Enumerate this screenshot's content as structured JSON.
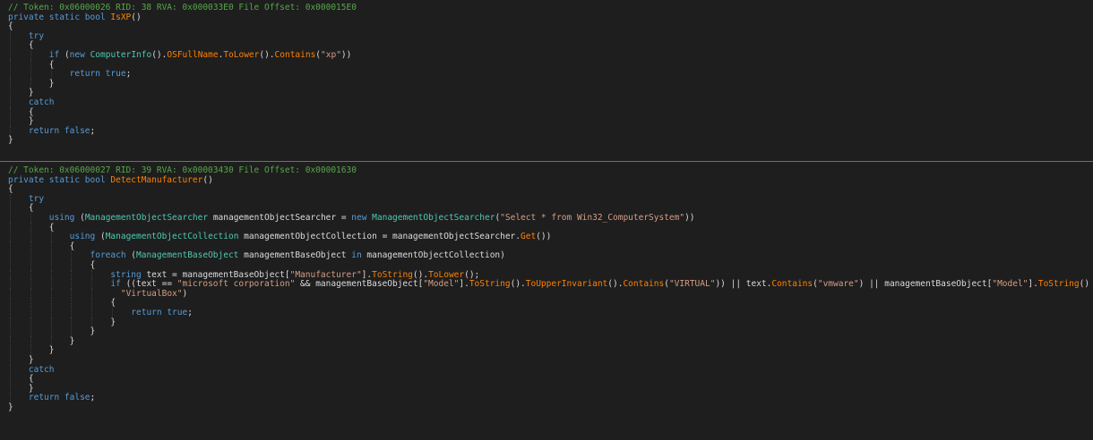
{
  "panes": [
    {
      "lines": [
        [
          [
            "c",
            "// Token: 0x06000026 RID: 38 RVA: 0x000033E0 File Offset: 0x000015E0"
          ]
        ],
        [
          [
            "k",
            "private static bool "
          ],
          [
            "m",
            "IsXP"
          ],
          [
            "p",
            "()"
          ]
        ],
        [
          [
            "p",
            "{"
          ]
        ],
        [
          [
            "p",
            "    "
          ],
          [
            "k",
            "try"
          ]
        ],
        [
          [
            "p",
            "    {"
          ]
        ],
        [
          [
            "p",
            "        "
          ],
          [
            "k",
            "if"
          ],
          [
            "p",
            " ("
          ],
          [
            "k",
            "new "
          ],
          [
            "t",
            "ComputerInfo"
          ],
          [
            "p",
            "()."
          ],
          [
            "m",
            "OSFullName"
          ],
          [
            "p",
            "."
          ],
          [
            "m",
            "ToLower"
          ],
          [
            "p",
            "()."
          ],
          [
            "m",
            "Contains"
          ],
          [
            "p",
            "("
          ],
          [
            "s",
            "\"xp\""
          ],
          [
            "p",
            "))"
          ]
        ],
        [
          [
            "p",
            "        {"
          ]
        ],
        [
          [
            "p",
            "            "
          ],
          [
            "k",
            "return true"
          ],
          [
            "p",
            ";"
          ]
        ],
        [
          [
            "p",
            "        }"
          ]
        ],
        [
          [
            "p",
            "    }"
          ]
        ],
        [
          [
            "p",
            "    "
          ],
          [
            "k",
            "catch"
          ]
        ],
        [
          [
            "p",
            "    {"
          ]
        ],
        [
          [
            "p",
            "    }"
          ]
        ],
        [
          [
            "p",
            "    "
          ],
          [
            "k",
            "return false"
          ],
          [
            "p",
            ";"
          ]
        ],
        [
          [
            "p",
            "}"
          ]
        ]
      ]
    },
    {
      "lines": [
        [
          [
            "c",
            "// Token: 0x06000027 RID: 39 RVA: 0x00003430 File Offset: 0x00001630"
          ]
        ],
        [
          [
            "k",
            "private static bool "
          ],
          [
            "m",
            "DetectManufacturer"
          ],
          [
            "p",
            "()"
          ]
        ],
        [
          [
            "p",
            "{"
          ]
        ],
        [
          [
            "p",
            "    "
          ],
          [
            "k",
            "try"
          ]
        ],
        [
          [
            "p",
            "    {"
          ]
        ],
        [
          [
            "p",
            "        "
          ],
          [
            "k",
            "using"
          ],
          [
            "p",
            " ("
          ],
          [
            "t",
            "ManagementObjectSearcher"
          ],
          [
            "p",
            " managementObjectSearcher = "
          ],
          [
            "k",
            "new "
          ],
          [
            "t",
            "ManagementObjectSearcher"
          ],
          [
            "p",
            "("
          ],
          [
            "s",
            "\"Select * from Win32_ComputerSystem\""
          ],
          [
            "p",
            "))"
          ]
        ],
        [
          [
            "p",
            "        {"
          ]
        ],
        [
          [
            "p",
            "            "
          ],
          [
            "k",
            "using"
          ],
          [
            "p",
            " ("
          ],
          [
            "t",
            "ManagementObjectCollection"
          ],
          [
            "p",
            " managementObjectCollection = managementObjectSearcher."
          ],
          [
            "m",
            "Get"
          ],
          [
            "p",
            "())"
          ]
        ],
        [
          [
            "p",
            "            {"
          ]
        ],
        [
          [
            "p",
            "                "
          ],
          [
            "k",
            "foreach"
          ],
          [
            "p",
            " ("
          ],
          [
            "t",
            "ManagementBaseObject"
          ],
          [
            "p",
            " managementBaseObject "
          ],
          [
            "k",
            "in"
          ],
          [
            "p",
            " managementObjectCollection)"
          ]
        ],
        [
          [
            "p",
            "                {"
          ]
        ],
        [
          [
            "p",
            "                    "
          ],
          [
            "k",
            "string"
          ],
          [
            "p",
            " text = managementBaseObject["
          ],
          [
            "s",
            "\"Manufacturer\""
          ],
          [
            "p",
            "]."
          ],
          [
            "m",
            "ToString"
          ],
          [
            "p",
            "()."
          ],
          [
            "m",
            "ToLower"
          ],
          [
            "p",
            "();"
          ]
        ],
        [
          [
            "p",
            "                    "
          ],
          [
            "k",
            "if"
          ],
          [
            "p",
            " ((text == "
          ],
          [
            "s",
            "\"microsoft corporation\""
          ],
          [
            "p",
            " && managementBaseObject["
          ],
          [
            "s",
            "\"Model\""
          ],
          [
            "p",
            "]."
          ],
          [
            "m",
            "ToString"
          ],
          [
            "p",
            "()."
          ],
          [
            "m",
            "ToUpperInvariant"
          ],
          [
            "p",
            "()."
          ],
          [
            "m",
            "Contains"
          ],
          [
            "p",
            "("
          ],
          [
            "s",
            "\"VIRTUAL\""
          ],
          [
            "p",
            ")) || text."
          ],
          [
            "m",
            "Contains"
          ],
          [
            "p",
            "("
          ],
          [
            "s",
            "\"vmware\""
          ],
          [
            "p",
            ") || managementBaseObject["
          ],
          [
            "s",
            "\"Model\""
          ],
          [
            "p",
            "]."
          ],
          [
            "m",
            "ToString"
          ],
          [
            "p",
            "() =="
          ]
        ],
        [
          [
            "p",
            "                      "
          ],
          [
            "s",
            "\"VirtualBox\""
          ],
          [
            "p",
            ")"
          ]
        ],
        [
          [
            "p",
            "                    {"
          ]
        ],
        [
          [
            "p",
            "                        "
          ],
          [
            "k",
            "return true"
          ],
          [
            "p",
            ";"
          ]
        ],
        [
          [
            "p",
            "                    }"
          ]
        ],
        [
          [
            "p",
            "                }"
          ]
        ],
        [
          [
            "p",
            "            }"
          ]
        ],
        [
          [
            "p",
            "        }"
          ]
        ],
        [
          [
            "p",
            "    }"
          ]
        ],
        [
          [
            "p",
            "    "
          ],
          [
            "k",
            "catch"
          ]
        ],
        [
          [
            "p",
            "    {"
          ]
        ],
        [
          [
            "p",
            "    }"
          ]
        ],
        [
          [
            "p",
            "    "
          ],
          [
            "k",
            "return false"
          ],
          [
            "p",
            ";"
          ]
        ],
        [
          [
            "p",
            "}"
          ]
        ]
      ]
    }
  ]
}
